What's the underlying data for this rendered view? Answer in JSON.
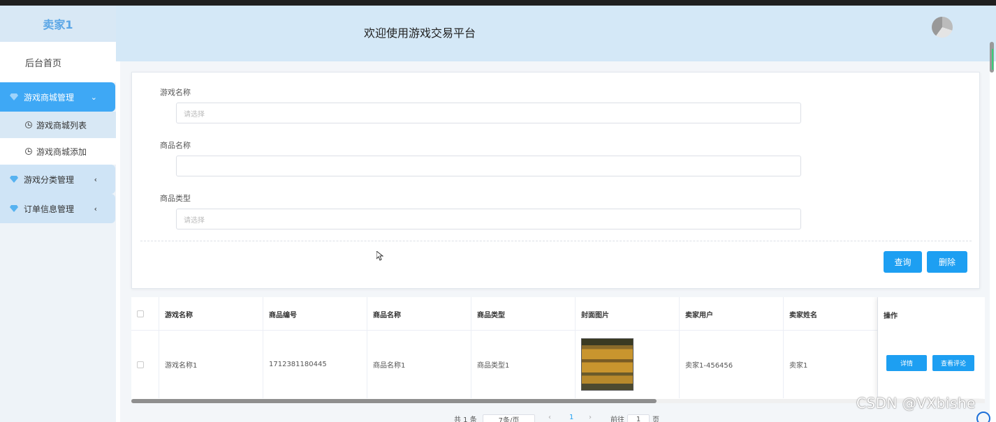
{
  "sidebar": {
    "brand": "卖家1",
    "home": "后台首页",
    "groups": [
      {
        "label": "游戏商城管理",
        "chevron": "⌄"
      },
      {
        "label": "游戏分类管理",
        "chevron": "‹"
      },
      {
        "label": "订单信息管理",
        "chevron": "‹"
      }
    ],
    "sub_items": [
      "游戏商城列表",
      "游戏商城添加"
    ]
  },
  "header": {
    "title": "欢迎使用游戏交易平台"
  },
  "form": {
    "fields": [
      {
        "label": "游戏名称",
        "placeholder": "请选择",
        "value": ""
      },
      {
        "label": "商品名称",
        "placeholder": "",
        "value": ""
      },
      {
        "label": "商品类型",
        "placeholder": "请选择",
        "value": ""
      }
    ],
    "query_label": "查询",
    "delete_label": "删除"
  },
  "table": {
    "columns": [
      "游戏名称",
      "商品编号",
      "商品名称",
      "商品类型",
      "封面图片",
      "卖家用户",
      "卖家姓名",
      "操作"
    ],
    "rows": [
      {
        "game_name": "游戏名称1",
        "product_no": "1712381180445",
        "product_name": "商品名称1",
        "product_type": "商品类型1",
        "seller_user": "卖家1-456456",
        "seller_name": "卖家1",
        "detail_label": "详情",
        "review_label": "查看评论"
      }
    ]
  },
  "pagination": {
    "total": "共 1 条",
    "page_size": "7条/页",
    "prev": "‹",
    "current": "1",
    "next": "›",
    "goto": "前往",
    "goto_value": "1",
    "page_unit": "页"
  },
  "watermark": "CSDN @VXbishe",
  "colors": {
    "accent": "#1d9ff2",
    "sidebar_active": "#3ea8f5",
    "header_bg": "#d4e8f7"
  }
}
